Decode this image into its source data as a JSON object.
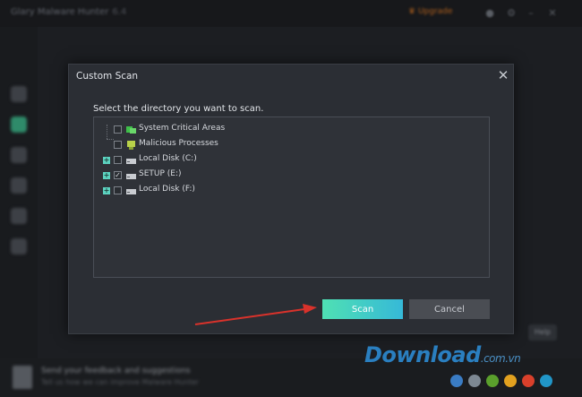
{
  "app": {
    "title": "Glary Malware Hunter",
    "version": "6.4",
    "upgrade_label": "Upgrade"
  },
  "bottom_bar": {
    "line1": "Send your feedback and suggestions",
    "line2": "Tell us how we can improve Malware Hunter",
    "button_label": "Help"
  },
  "dialog": {
    "title": "Custom Scan",
    "close_glyph": "✕",
    "prompt": "Select the directory you want to scan.",
    "items": [
      {
        "label": "System Critical Areas",
        "checked": false,
        "expandable": false,
        "icon": "shield-icon"
      },
      {
        "label": "Malicious Processes",
        "checked": false,
        "expandable": false,
        "icon": "process-icon"
      },
      {
        "label": "Local Disk (C:)",
        "checked": false,
        "expandable": true,
        "icon": "drive-icon"
      },
      {
        "label": "SETUP (E:)",
        "checked": true,
        "expandable": true,
        "icon": "drive-icon"
      },
      {
        "label": "Local Disk (F:)",
        "checked": false,
        "expandable": true,
        "icon": "drive-icon"
      }
    ],
    "scan_label": "Scan",
    "cancel_label": "Cancel",
    "expand_glyph": "+",
    "check_glyph": "✓"
  },
  "watermark": {
    "text": "Download",
    "suffix": ".com.vn",
    "dot_colors": [
      "#3a7cc4",
      "#7d8893",
      "#5aa02c",
      "#e2a11f",
      "#d9402b",
      "#2196c8"
    ]
  },
  "colors": {
    "accent_start": "#4fe0b3",
    "accent_end": "#36b9d8",
    "arrow": "#d9322b"
  }
}
